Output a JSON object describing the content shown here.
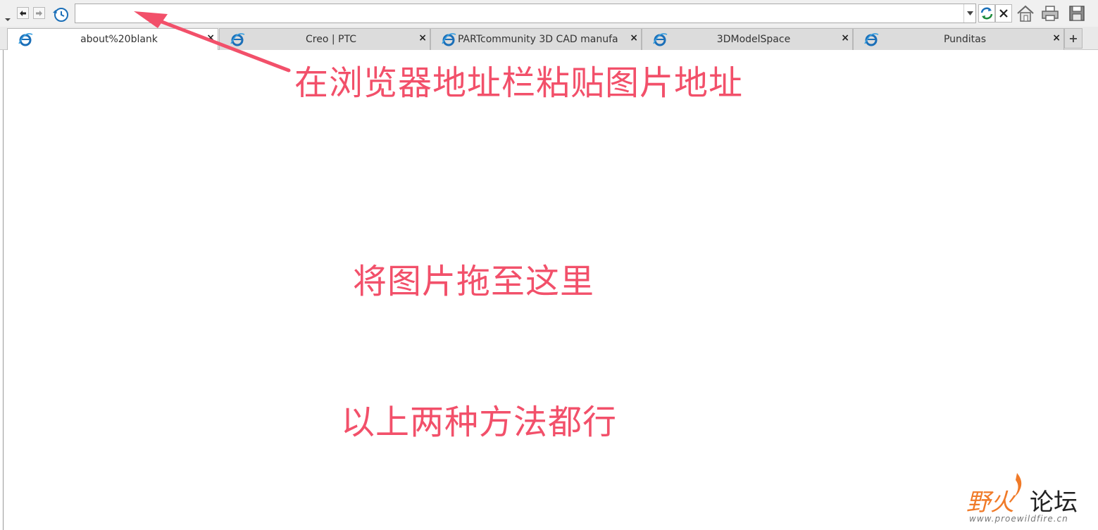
{
  "toolbar": {
    "address_value": "",
    "icons": [
      "menu-arrow-icon",
      "back-icon",
      "forward-icon",
      "history-icon",
      "dropdown-icon",
      "refresh-icon",
      "stop-icon",
      "home-icon",
      "print-icon",
      "save-icon"
    ]
  },
  "tabs": [
    {
      "label": "about%20blank",
      "active": true
    },
    {
      "label": "Creo | PTC",
      "active": false
    },
    {
      "label": "PARTcommunity 3D CAD manufa",
      "active": false
    },
    {
      "label": "3DModelSpace",
      "active": false
    },
    {
      "label": "Punditas",
      "active": false
    }
  ],
  "new_tab_label": "+",
  "close_glyph": "×",
  "annotations": {
    "paste_address": "在浏览器地址栏粘贴图片地址",
    "drag_here": "将图片拖至这里",
    "both_work": "以上两种方法都行"
  },
  "watermark": {
    "name_part1": "野火",
    "name_part2": "论坛",
    "url": "www.proewildfire.cn"
  },
  "colors": {
    "annotation": "#f2506a",
    "accent_blue": "#1b6fb8"
  }
}
